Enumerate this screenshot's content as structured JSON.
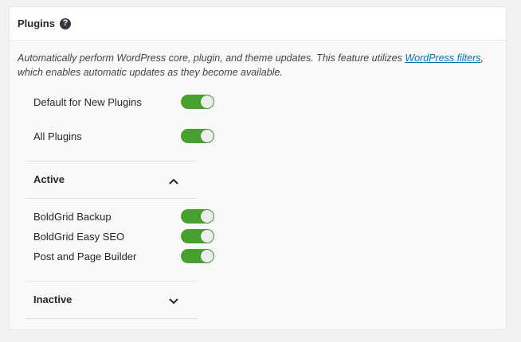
{
  "header": {
    "title": "Plugins",
    "help_icon": "question-icon"
  },
  "description": {
    "text_before": "Automatically perform WordPress core, plugin, and theme updates. This feature utilizes ",
    "link_text": "WordPress filters",
    "text_after": ",",
    "line2": "which enables automatic updates as they become available."
  },
  "global_toggles": [
    {
      "label": "Default for New Plugins",
      "on": true
    },
    {
      "label": "All Plugins",
      "on": true
    }
  ],
  "active_section": {
    "label": "Active",
    "expanded": true,
    "plugins": [
      {
        "label": "BoldGrid Backup",
        "on": true
      },
      {
        "label": "BoldGrid Easy SEO",
        "on": true
      },
      {
        "label": "Post and Page Builder",
        "on": true
      }
    ]
  },
  "inactive_section": {
    "label": "Inactive",
    "expanded": false
  },
  "colors": {
    "toggle_on": "#46a02d",
    "link": "#0073aa"
  }
}
